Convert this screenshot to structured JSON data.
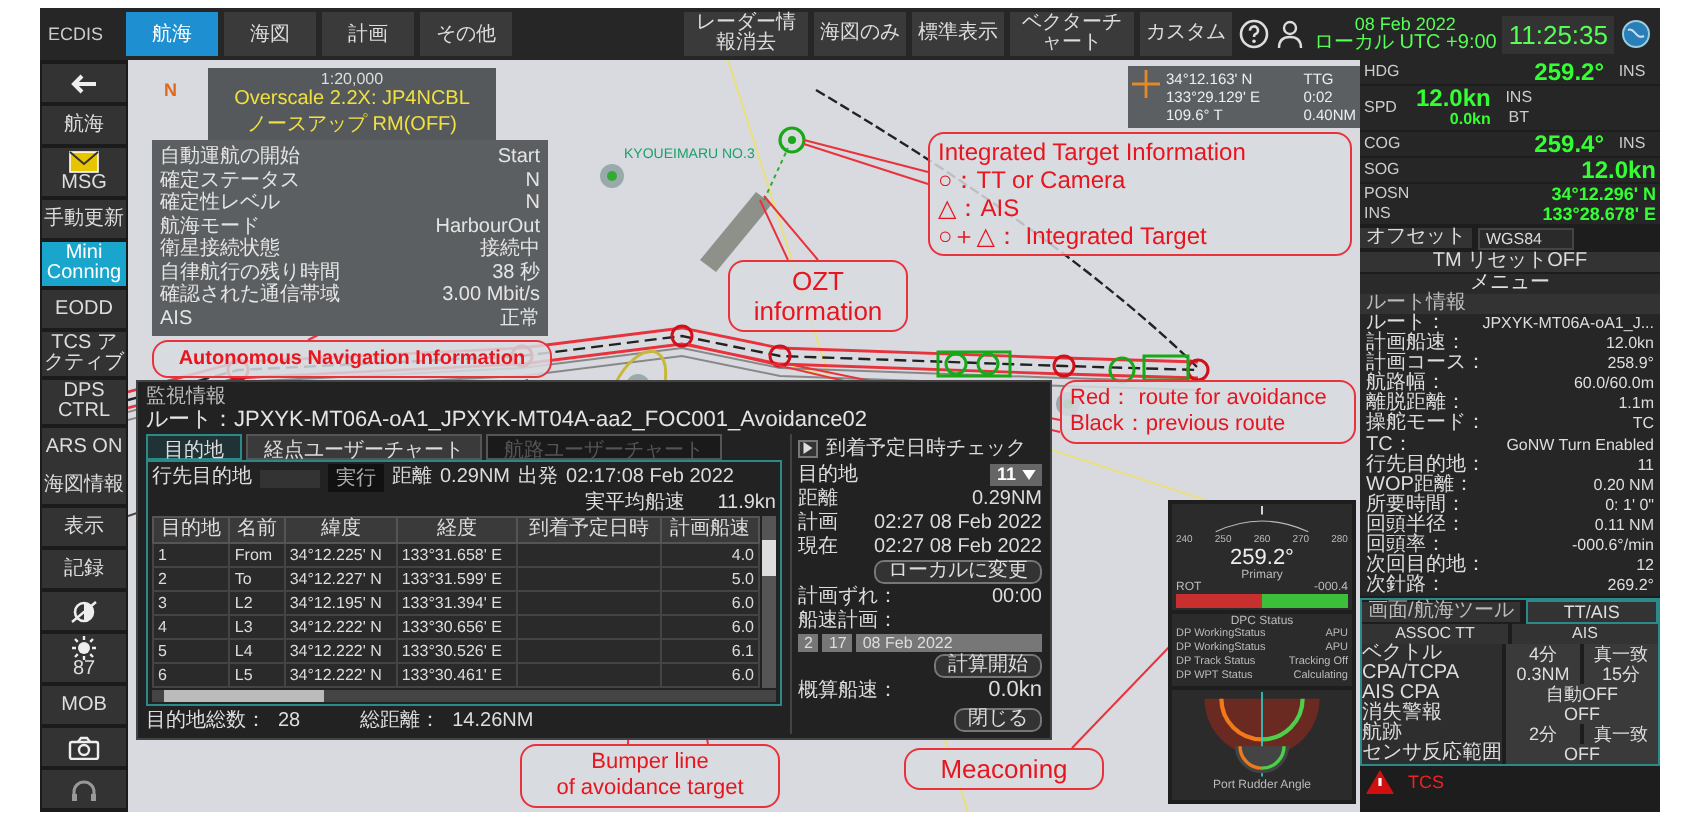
{
  "topbar": {
    "app": "ECDIS",
    "tabs": [
      {
        "label": "航海",
        "selected": true
      },
      {
        "label": "海図",
        "selected": false
      },
      {
        "label": "計画",
        "selected": false
      },
      {
        "label": "その他",
        "selected": false
      }
    ],
    "buttons": [
      "レーダー情報消去",
      "海図のみ",
      "標準表示",
      "ベクターチャート",
      "カスタム"
    ],
    "date": "08 Feb 2022",
    "timezone": "ローカル UTC +9:00",
    "time": "11:25:35"
  },
  "sidebar": {
    "top": [
      {
        "kind": "back",
        "selected": false
      },
      {
        "kind": "text",
        "label": "航海",
        "selected": false
      },
      {
        "kind": "mail",
        "label": "MSG",
        "selected": false
      },
      {
        "kind": "text",
        "label": "手動更新",
        "selected": false
      },
      {
        "kind": "text",
        "label": "Mini Conning",
        "selected": true
      },
      {
        "kind": "text",
        "label": "EODD",
        "selected": false
      },
      {
        "kind": "text",
        "label": "TCS アクティブ",
        "selected": false
      },
      {
        "kind": "text",
        "label": "DPS CTRL",
        "selected": false
      },
      {
        "kind": "text",
        "label": "ARS ON",
        "selected": false
      }
    ],
    "bottom": [
      {
        "kind": "text",
        "label": "海図情報",
        "selected": false
      },
      {
        "kind": "text",
        "label": "表示",
        "selected": false
      },
      {
        "kind": "text",
        "label": "記録",
        "selected": false
      },
      {
        "kind": "dimmer",
        "selected": false
      },
      {
        "kind": "sun",
        "label": "87",
        "selected": false
      },
      {
        "kind": "text",
        "label": "MOB",
        "selected": false
      },
      {
        "kind": "camera",
        "selected": false
      },
      {
        "kind": "headset",
        "selected": false
      }
    ]
  },
  "chart": {
    "north": "N",
    "scale": "1:20,000",
    "overscale": "Overscale 2.2X: JP4NCBL",
    "orientation": "ノースアップ RM(OFF)",
    "target_name": "KYOUEIMARU NO.3"
  },
  "autonomous_info": [
    {
      "label": "自動運航の開始",
      "value": "Start"
    },
    {
      "label": "確定ステータス",
      "value": "N"
    },
    {
      "label": "確定性レベル",
      "value": "N"
    },
    {
      "label": "航海モード",
      "value": "HarbourOut"
    },
    {
      "label": "衛星接続状態",
      "value": "接続中"
    },
    {
      "label": "自律航行の残り時間",
      "value": "38 秒"
    },
    {
      "label": "確認された通信帯域",
      "value": "3.00 Mbit/s"
    },
    {
      "label": "AIS",
      "value": "正常"
    }
  ],
  "cursor": {
    "lat": "34°12.163' N",
    "lon": "133°29.129' E",
    "ttg_label": "TTG",
    "ttg": "0:02",
    "bearing": "109.6° T",
    "distance": "0.40NM"
  },
  "annotations": [
    {
      "kind": "auto",
      "lines": [
        "Autonomous Navigation Information"
      ]
    },
    {
      "kind": "integrated",
      "lines": [
        "Integrated Target Information",
        "○：TT or Camera",
        "△：AIS",
        "○＋△： Integrated Target"
      ]
    },
    {
      "kind": "ozt",
      "lines": [
        "OZT",
        "information"
      ]
    },
    {
      "kind": "route",
      "lines": [
        "Red： route for avoidance",
        "Black：previous route"
      ]
    },
    {
      "kind": "bumper",
      "lines": [
        "Bumper line",
        "of avoidance target"
      ]
    },
    {
      "kind": "meaconing",
      "lines": [
        "Meaconing"
      ]
    }
  ],
  "monitor": {
    "title": "監視情報",
    "route": "ルート：JPXYK-MT06A-oA1_JPXYK-MT04A-aa2_FOC001_Avoidance02",
    "tabs": [
      {
        "label": "目的地",
        "selected": true,
        "disabled": false
      },
      {
        "label": "経点ユーザーチャート",
        "selected": false,
        "disabled": false
      },
      {
        "label": "航路ユーザーチャート",
        "selected": false,
        "disabled": true
      }
    ],
    "dest_label": "行先目的地",
    "go_button": "実行",
    "distance_label": "距離",
    "distance": "0.29NM",
    "depart_label": "出発",
    "depart": "02:17:08 Feb 2022",
    "avg_label": "実平均船速",
    "avg": "11.9kn",
    "columns": [
      "目的地",
      "名前",
      "緯度",
      "経度",
      "到着予定日時",
      "計画船速"
    ],
    "rows": [
      {
        "no": "1",
        "name": "From",
        "lat": "34°12.225' N",
        "lon": "133°31.658' E",
        "speed": "4.0"
      },
      {
        "no": "2",
        "name": "To",
        "lat": "34°12.227' N",
        "lon": "133°31.599' E",
        "speed": "5.0"
      },
      {
        "no": "3",
        "name": "L2",
        "lat": "34°12.195' N",
        "lon": "133°31.394' E",
        "speed": "6.0"
      },
      {
        "no": "4",
        "name": "L3",
        "lat": "34°12.222' N",
        "lon": "133°30.656' E",
        "speed": "6.0"
      },
      {
        "no": "5",
        "name": "L4",
        "lat": "34°12.222' N",
        "lon": "133°30.526' E",
        "speed": "6.1"
      },
      {
        "no": "6",
        "name": "L5",
        "lat": "34°12.222' N",
        "lon": "133°30.461' E",
        "speed": "6.0"
      }
    ],
    "total_label": "目的地総数：",
    "total": "28",
    "dist_label": "総距離：",
    "dist": "14.26NM",
    "close": "閉じる",
    "check_title": "到着予定日時チェック",
    "check_rows": [
      {
        "kind": "select",
        "label": "目的地",
        "value": "11"
      },
      {
        "kind": "text",
        "label": "距離",
        "value": "0.29NM"
      },
      {
        "kind": "text",
        "label": "計画",
        "value": "02:27 08 Feb 2022"
      },
      {
        "kind": "text",
        "label": "現在",
        "value": "02:27 08 Feb 2022"
      }
    ],
    "local_button": "ローカルに変更",
    "deviation_label": "計画ずれ：",
    "deviation": "00:00",
    "plan_label": "船速計画：",
    "plan_inputs": [
      "2",
      "17",
      "08 Feb 2022"
    ],
    "calc_button": "計算開始",
    "estimate_label": "概算船速：",
    "estimate": "0.0kn"
  },
  "conning": {
    "ticks": [
      "240",
      "250",
      "260",
      "270",
      "280"
    ],
    "heading": "259.2°",
    "source": "Primary",
    "rot_label": "ROT",
    "rot_value": "-000.4",
    "dpc_title": "DPC Status",
    "dpc": [
      {
        "label": "DP WorkingStatus",
        "value": "APU"
      },
      {
        "label": "DP WorkingStatus",
        "value": "APU"
      },
      {
        "label": "DP Track Status",
        "value": "Tracking Off"
      },
      {
        "label": "DP WPT Status",
        "value": "Calculating"
      }
    ],
    "rudder_label": "Port Rudder Angle"
  },
  "nav": {
    "hdg": {
      "label": "HDG",
      "value": "259.2°",
      "src": "INS"
    },
    "spd": {
      "label": "SPD",
      "value": "12.0kn",
      "sub": "0.0kn",
      "src": "INS",
      "src2": "BT"
    },
    "cog": {
      "label": "COG",
      "value": "259.4°",
      "src": "INS"
    },
    "sog": {
      "label": "SOG",
      "value": "12.0kn"
    },
    "posn": {
      "label": "POSN",
      "src": "INS",
      "lat": "34°12.296' N",
      "lon": "133°28.678' E"
    },
    "offset": "オフセット",
    "datum": "WGS84",
    "reset": "TM リセットOFF",
    "menu": "メニュー"
  },
  "route_info": {
    "title": "ルート情報",
    "rows": [
      {
        "label": "ルート：",
        "value": "JPXYK-MT06A-oA1_J..."
      },
      {
        "label": "計画船速：",
        "value": "12.0kn"
      },
      {
        "label": "計画コース：",
        "value": "258.9°"
      },
      {
        "label": "航路幅：",
        "value": "60.0/60.0m"
      },
      {
        "label": "離脱距離：",
        "value": "1.1m"
      },
      {
        "label": "操舵モード：",
        "value": "TC"
      }
    ],
    "tc_rows": [
      {
        "label": "TC：",
        "value": "GoNW Turn Enabled"
      },
      {
        "label": "行先目的地：",
        "value": "11"
      },
      {
        "label": "WOP距離：",
        "value": "0.20 NM"
      },
      {
        "label": "所要時間：",
        "value": "0: 1' 0\""
      },
      {
        "label": "回頭半径：",
        "value": "0.11 NM"
      },
      {
        "label": "回頭率：",
        "value": "-000.6°/min"
      },
      {
        "label": "次回目的地：",
        "value": "12"
      },
      {
        "label": "次針路：",
        "value": "269.2°"
      }
    ]
  },
  "tools": {
    "title": "画面/航海ツール",
    "tab": "TT/AIS",
    "assoc": "ASSOC TT",
    "ais": "AIS",
    "rows": [
      {
        "label": "ベクトル",
        "values": [
          "4分",
          "真一致"
        ]
      },
      {
        "label": "CPA/TCPA",
        "values": [
          "0.3NM",
          "15分"
        ]
      },
      {
        "label": "AIS CPA",
        "values": [
          "自動OFF"
        ]
      },
      {
        "label": "消失警報",
        "values": [
          "OFF"
        ]
      },
      {
        "label": "航跡",
        "values": [
          "2分",
          "真一致"
        ]
      },
      {
        "label": "センサ反応範囲",
        "values": [
          "OFF"
        ]
      }
    ],
    "alert": "TCS"
  }
}
